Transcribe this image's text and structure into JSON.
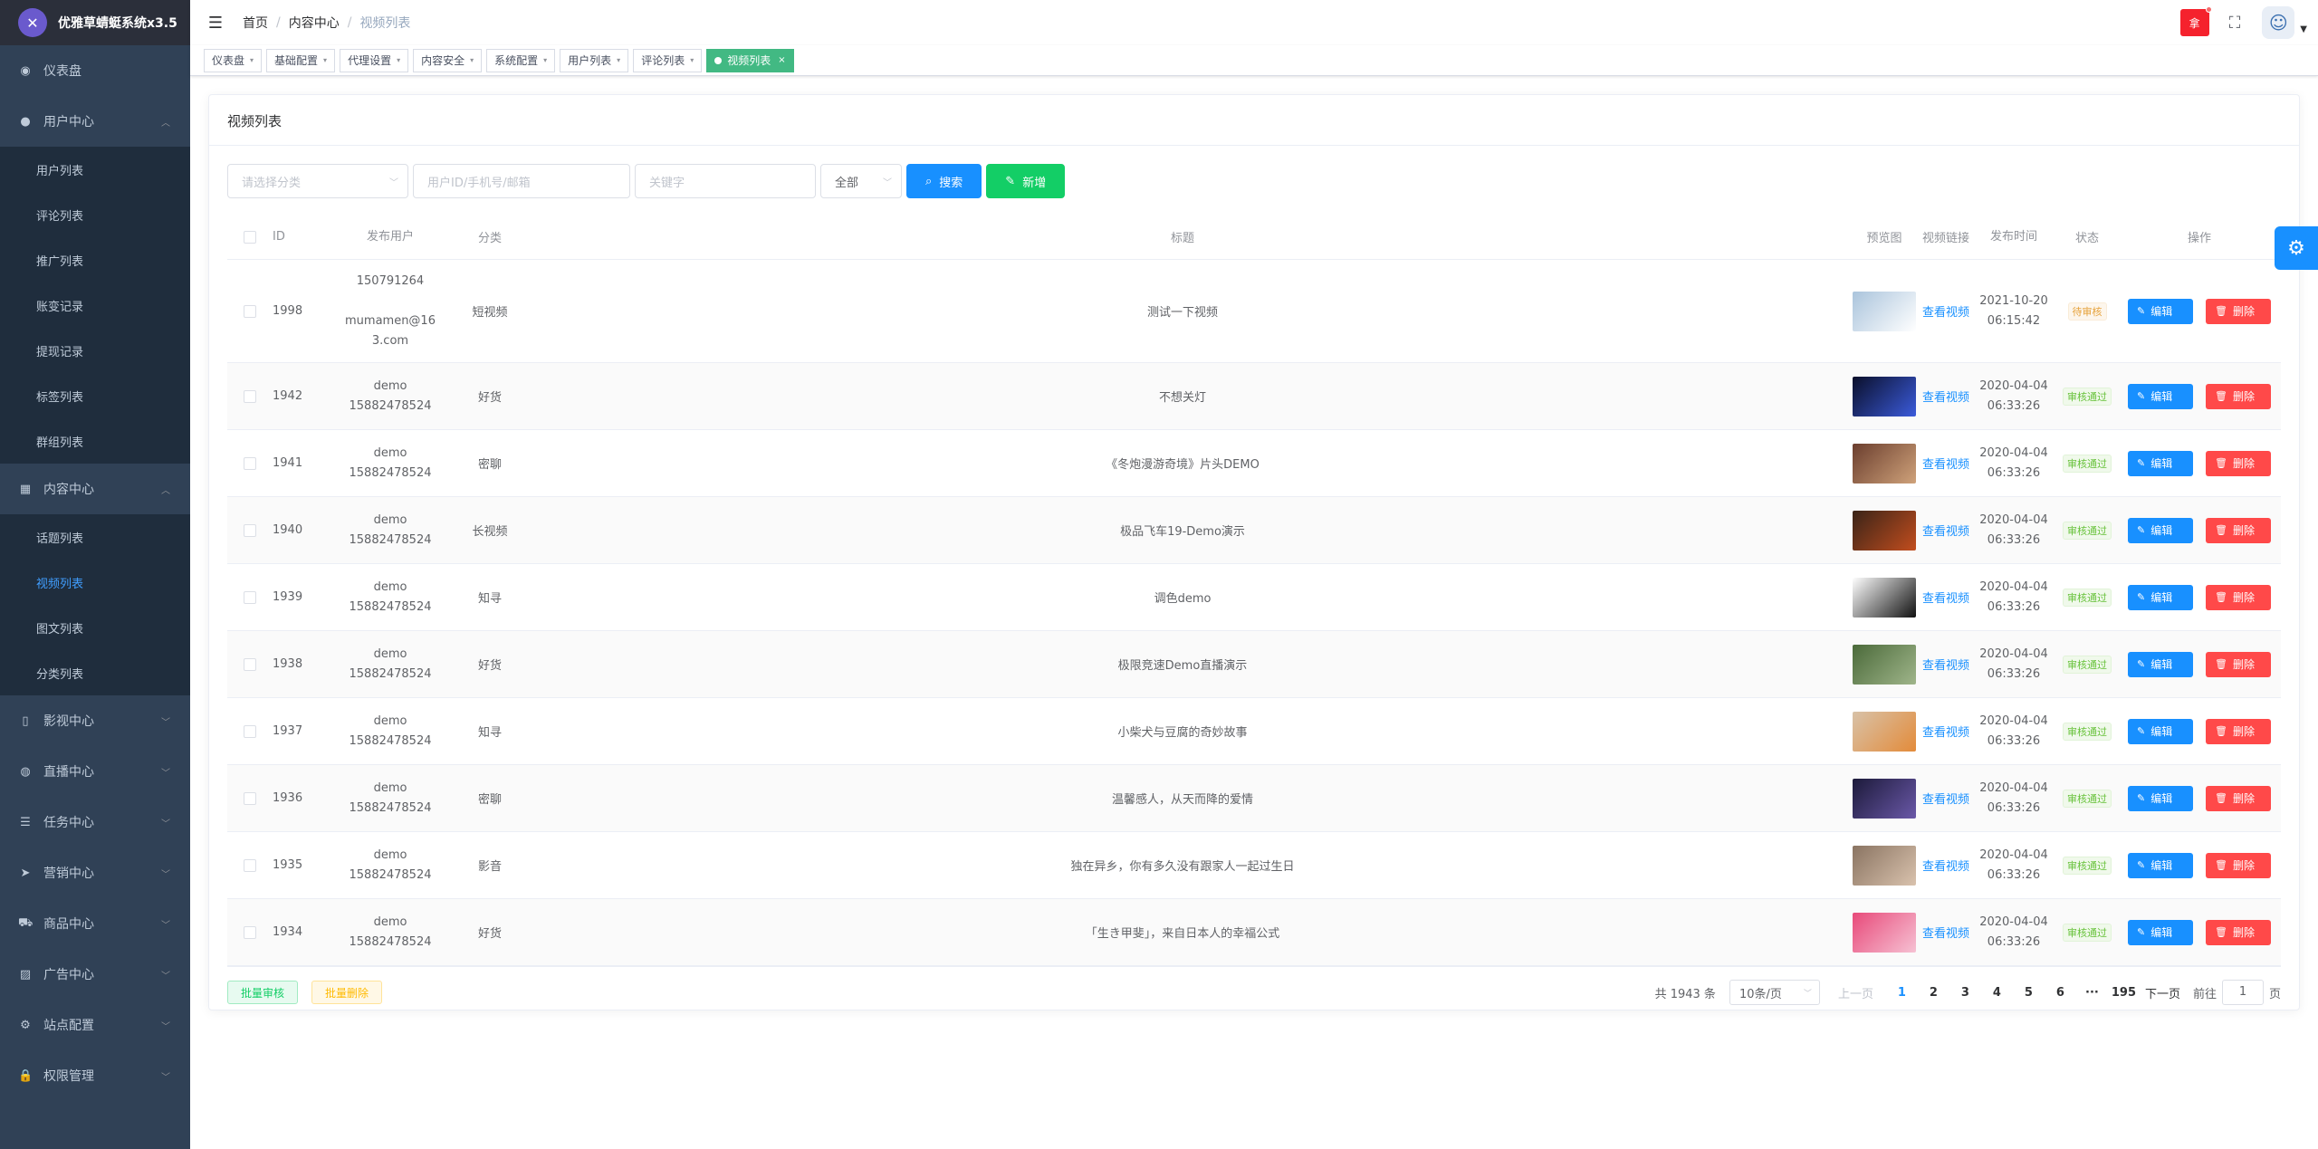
{
  "app": {
    "title": "优雅草蜻蜓系统x3.5"
  },
  "sidebar": {
    "items": [
      {
        "label": "仪表盘",
        "icon": "dashboard-icon",
        "glyph": "◉"
      },
      {
        "label": "用户中心",
        "icon": "user-icon",
        "glyph": "●",
        "expanded": true,
        "children": [
          "用户列表",
          "评论列表",
          "推广列表",
          "账变记录",
          "提现记录",
          "标签列表",
          "群组列表"
        ]
      },
      {
        "label": "内容中心",
        "icon": "grid-icon",
        "glyph": "▦",
        "expanded": true,
        "children": [
          "话题列表",
          "视频列表",
          "图文列表",
          "分类列表"
        ]
      },
      {
        "label": "影视中心",
        "icon": "book-icon",
        "glyph": "▯"
      },
      {
        "label": "直播中心",
        "icon": "globe-icon",
        "glyph": "◍"
      },
      {
        "label": "任务中心",
        "icon": "list-icon",
        "glyph": "☰"
      },
      {
        "label": "营销中心",
        "icon": "send-icon",
        "glyph": "➤"
      },
      {
        "label": "商品中心",
        "icon": "cart-icon",
        "glyph": "⛟"
      },
      {
        "label": "广告中心",
        "icon": "chart-icon",
        "glyph": "▨"
      },
      {
        "label": "站点配置",
        "icon": "settings-icon",
        "glyph": "⚙"
      },
      {
        "label": "权限管理",
        "icon": "lock-icon",
        "glyph": "🔒"
      }
    ],
    "active_sub": "视频列表"
  },
  "header": {
    "breadcrumb": [
      "首页",
      "内容中心",
      "视频列表"
    ],
    "notice_label": "拿"
  },
  "tags": [
    {
      "label": "仪表盘",
      "active": false
    },
    {
      "label": "基础配置",
      "active": false
    },
    {
      "label": "代理设置",
      "active": false
    },
    {
      "label": "内容安全",
      "active": false
    },
    {
      "label": "系统配置",
      "active": false
    },
    {
      "label": "用户列表",
      "active": false
    },
    {
      "label": "评论列表",
      "active": false
    },
    {
      "label": "视频列表",
      "active": true
    }
  ],
  "card": {
    "title": "视频列表"
  },
  "filters": {
    "category_placeholder": "请选择分类",
    "user_placeholder": "用户ID/手机号/邮箱",
    "keyword_placeholder": "关键字",
    "status_value": "全部",
    "search_label": "搜索",
    "add_label": "新增"
  },
  "table": {
    "headers": {
      "id": "ID",
      "user": "发布用户",
      "category": "分类",
      "title": "标题",
      "preview": "预览图",
      "link": "视频链接",
      "time": "发布时间",
      "status": "状态",
      "ops": "操作"
    },
    "link_label": "查看视频",
    "edit_label": "编辑",
    "delete_label": "删除",
    "rows": [
      {
        "id": "1998",
        "user1": "150791264",
        "user2": "",
        "user3": "mumamen@16",
        "user4": "3.com",
        "category": "短视频",
        "title": "测试一下视频",
        "date": "2021-10-20",
        "time": "06:15:42",
        "status": "待审核",
        "status_type": "pending",
        "thumb": [
          "#aac4dc",
          "#ffffff"
        ]
      },
      {
        "id": "1942",
        "user1": "demo",
        "user2": "15882478524",
        "category": "好货",
        "title": "不想关灯",
        "date": "2020-04-04",
        "time": "06:33:26",
        "status": "审核通过",
        "status_type": "ok",
        "thumb": [
          "#0a0f2a",
          "#3b5bdb"
        ]
      },
      {
        "id": "1941",
        "user1": "demo",
        "user2": "15882478524",
        "category": "密聊",
        "title": "《冬炮漫游奇境》片头DEMO",
        "date": "2020-04-04",
        "time": "06:33:26",
        "status": "审核通过",
        "status_type": "ok",
        "thumb": [
          "#6b3e2e",
          "#cfa27a"
        ]
      },
      {
        "id": "1940",
        "user1": "demo",
        "user2": "15882478524",
        "category": "长视频",
        "title": "极品飞车19-Demo演示",
        "date": "2020-04-04",
        "time": "06:33:26",
        "status": "审核通过",
        "status_type": "ok",
        "thumb": [
          "#3a2418",
          "#c24d1e"
        ]
      },
      {
        "id": "1939",
        "user1": "demo",
        "user2": "15882478524",
        "category": "知寻",
        "title": "调色demo",
        "date": "2020-04-04",
        "time": "06:33:26",
        "status": "审核通过",
        "status_type": "ok",
        "thumb": [
          "#ffffff",
          "#111111"
        ]
      },
      {
        "id": "1938",
        "user1": "demo",
        "user2": "15882478524",
        "category": "好货",
        "title": "极限竞速Demo直播演示",
        "date": "2020-04-04",
        "time": "06:33:26",
        "status": "审核通过",
        "status_type": "ok",
        "thumb": [
          "#4b6a3a",
          "#9fb58a"
        ]
      },
      {
        "id": "1937",
        "user1": "demo",
        "user2": "15882478524",
        "category": "知寻",
        "title": "小柴犬与豆腐的奇妙故事",
        "date": "2020-04-04",
        "time": "06:33:26",
        "status": "审核通过",
        "status_type": "ok",
        "thumb": [
          "#d8c2a8",
          "#e38b3a"
        ]
      },
      {
        "id": "1936",
        "user1": "demo",
        "user2": "15882478524",
        "category": "密聊",
        "title": "温馨感人，从天而降的爱情",
        "date": "2020-04-04",
        "time": "06:33:26",
        "status": "审核通过",
        "status_type": "ok",
        "thumb": [
          "#1c1a3a",
          "#6a58a8"
        ]
      },
      {
        "id": "1935",
        "user1": "demo",
        "user2": "15882478524",
        "category": "影音",
        "title": "独在异乡，你有多久没有跟家人一起过生日",
        "date": "2020-04-04",
        "time": "06:33:26",
        "status": "审核通过",
        "status_type": "ok",
        "thumb": [
          "#8a7462",
          "#d9c2ad"
        ]
      },
      {
        "id": "1934",
        "user1": "demo",
        "user2": "15882478524",
        "category": "好货",
        "title": "「生き甲斐」，来自日本人的幸福公式",
        "date": "2020-04-04",
        "time": "06:33:26",
        "status": "审核通过",
        "status_type": "ok",
        "thumb": [
          "#e84a7a",
          "#f6c1d3"
        ]
      }
    ]
  },
  "bottom": {
    "batch_audit": "批量审核",
    "batch_delete": "批量删除"
  },
  "pager": {
    "total": "共 1943 条",
    "size": "10条/页",
    "prev": "上一页",
    "pages": [
      "1",
      "2",
      "3",
      "4",
      "5",
      "6",
      "···",
      "195"
    ],
    "next": "下一页",
    "goto": "前往",
    "goto_value": "1",
    "page_suffix": "页"
  }
}
